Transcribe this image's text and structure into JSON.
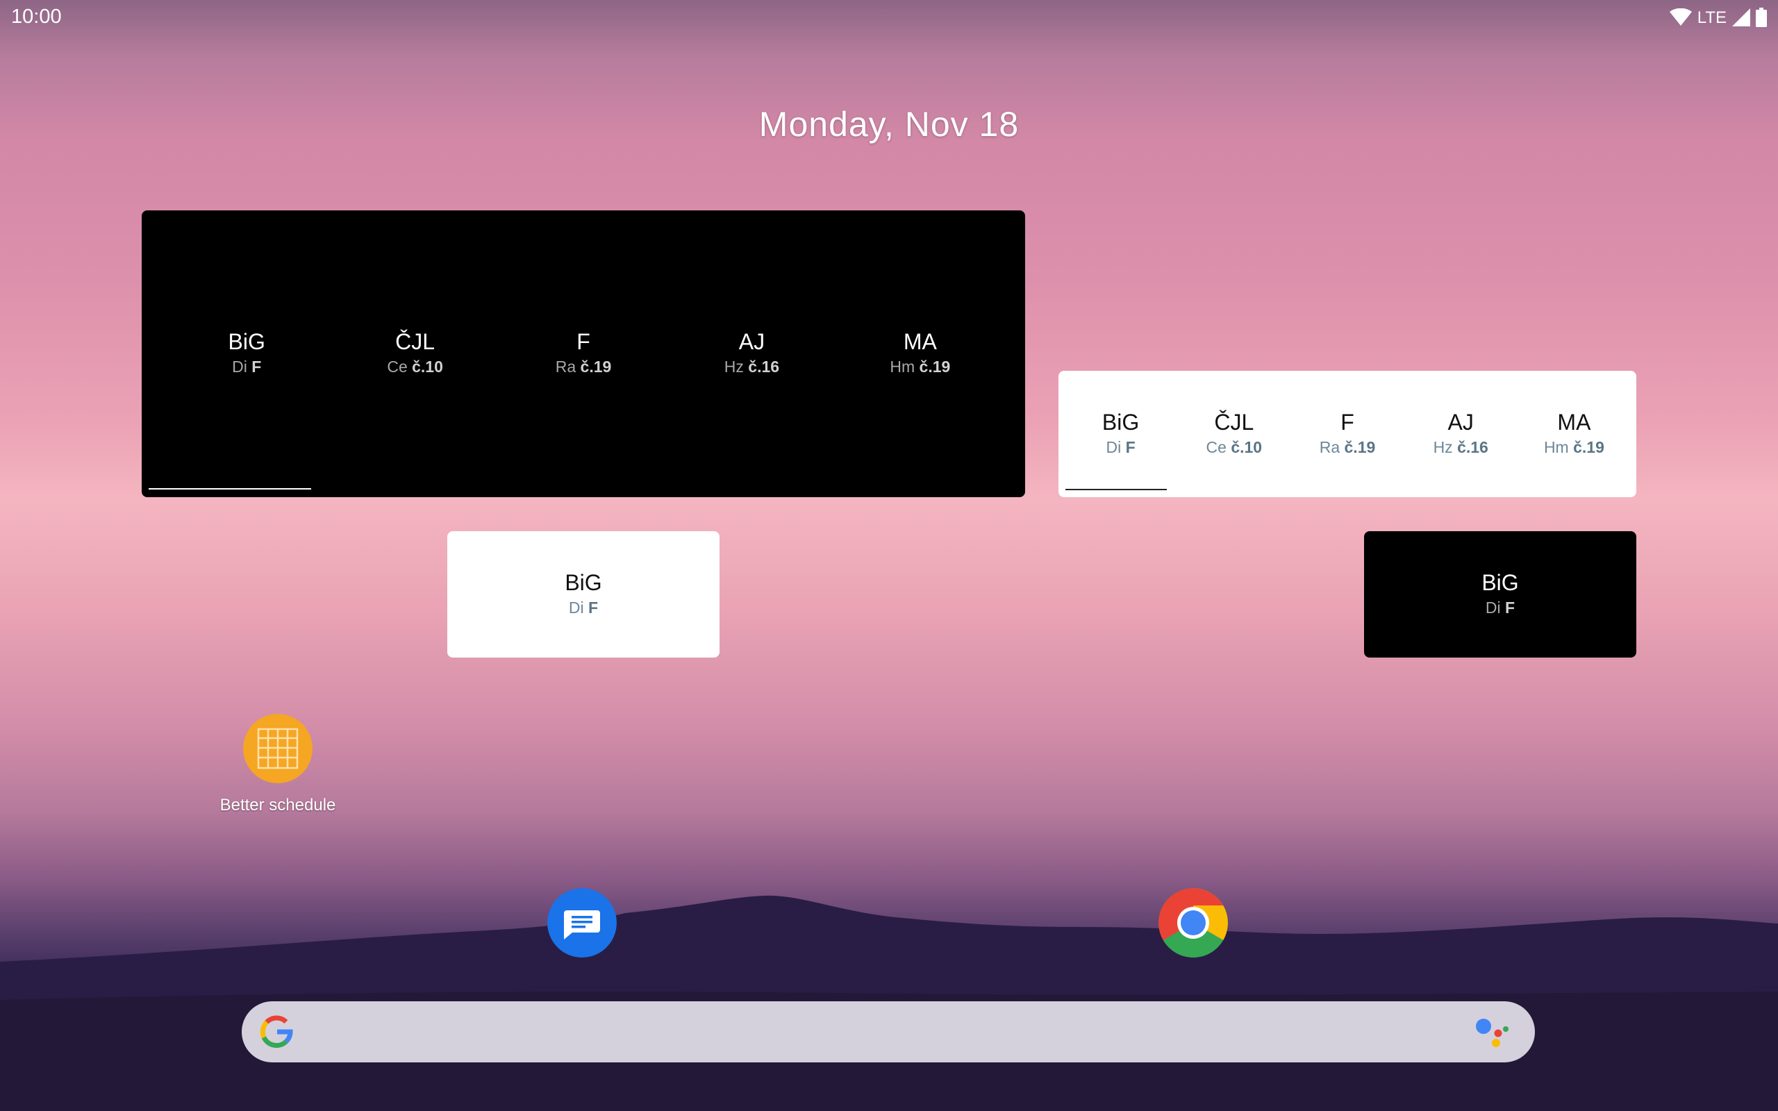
{
  "status_bar": {
    "time": "10:00",
    "network": "LTE"
  },
  "home": {
    "date": "Monday, Nov 18"
  },
  "widgets": {
    "large_dark": {
      "lessons": [
        {
          "subject": "BiG",
          "teacher": "Di",
          "room": "F"
        },
        {
          "subject": "ČJL",
          "teacher": "Ce",
          "room": "č.10"
        },
        {
          "subject": "F",
          "teacher": "Ra",
          "room": "č.19"
        },
        {
          "subject": "AJ",
          "teacher": "Hz",
          "room": "č.16"
        },
        {
          "subject": "MA",
          "teacher": "Hm",
          "room": "č.19"
        }
      ]
    },
    "wide_light": {
      "lessons": [
        {
          "subject": "BiG",
          "teacher": "Di",
          "room": "F"
        },
        {
          "subject": "ČJL",
          "teacher": "Ce",
          "room": "č.10"
        },
        {
          "subject": "F",
          "teacher": "Ra",
          "room": "č.19"
        },
        {
          "subject": "AJ",
          "teacher": "Hz",
          "room": "č.16"
        },
        {
          "subject": "MA",
          "teacher": "Hm",
          "room": "č.19"
        }
      ]
    },
    "small_light": {
      "subject": "BiG",
      "teacher": "Di",
      "room": "F"
    },
    "small_dark": {
      "subject": "BiG",
      "teacher": "Di",
      "room": "F"
    }
  },
  "apps": {
    "better_schedule": {
      "label": "Better schedule",
      "icon": "calendar-grid-icon",
      "color": "#f5a623"
    },
    "messages": {
      "icon": "messages-icon",
      "color": "#1a73e8"
    },
    "chrome": {
      "icon": "chrome-icon"
    }
  },
  "search": {
    "icon": "google-g-icon",
    "assistant_icon": "assistant-dots-icon"
  }
}
